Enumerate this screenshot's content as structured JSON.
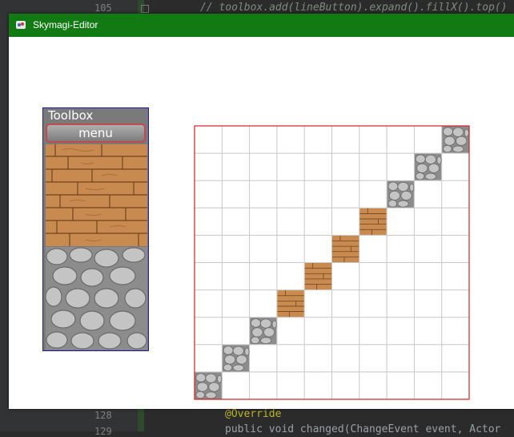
{
  "ide": {
    "line_numbers": [
      "105",
      "128",
      "129"
    ],
    "code_top": "// toolbox.add(lineButton).expand().fillX().top()",
    "code_annotation": "@Override",
    "code_bottom": "public void changed(ChangeEvent event, Actor"
  },
  "window": {
    "title": "Skymagi-Editor",
    "icon": "app-icon",
    "titlebar_color": "#127a12"
  },
  "toolbox": {
    "title": "Toolbox",
    "menu_label": "menu",
    "tiles": [
      {
        "name": "wood",
        "icon": "wood-tile-icon"
      },
      {
        "name": "stone",
        "icon": "stone-tile-icon"
      }
    ]
  },
  "grid": {
    "columns": 10,
    "rows": 10,
    "border_color": "#d42020",
    "line_color": "#c8c8c8",
    "cells": [
      {
        "col": 0,
        "row": 9,
        "tile": "stone"
      },
      {
        "col": 1,
        "row": 8,
        "tile": "stone"
      },
      {
        "col": 2,
        "row": 7,
        "tile": "stone"
      },
      {
        "col": 3,
        "row": 6,
        "tile": "wood"
      },
      {
        "col": 4,
        "row": 5,
        "tile": "wood"
      },
      {
        "col": 5,
        "row": 4,
        "tile": "wood"
      },
      {
        "col": 6,
        "row": 3,
        "tile": "wood"
      },
      {
        "col": 7,
        "row": 2,
        "tile": "stone"
      },
      {
        "col": 8,
        "row": 1,
        "tile": "stone"
      },
      {
        "col": 9,
        "row": 0,
        "tile": "stone"
      }
    ]
  }
}
